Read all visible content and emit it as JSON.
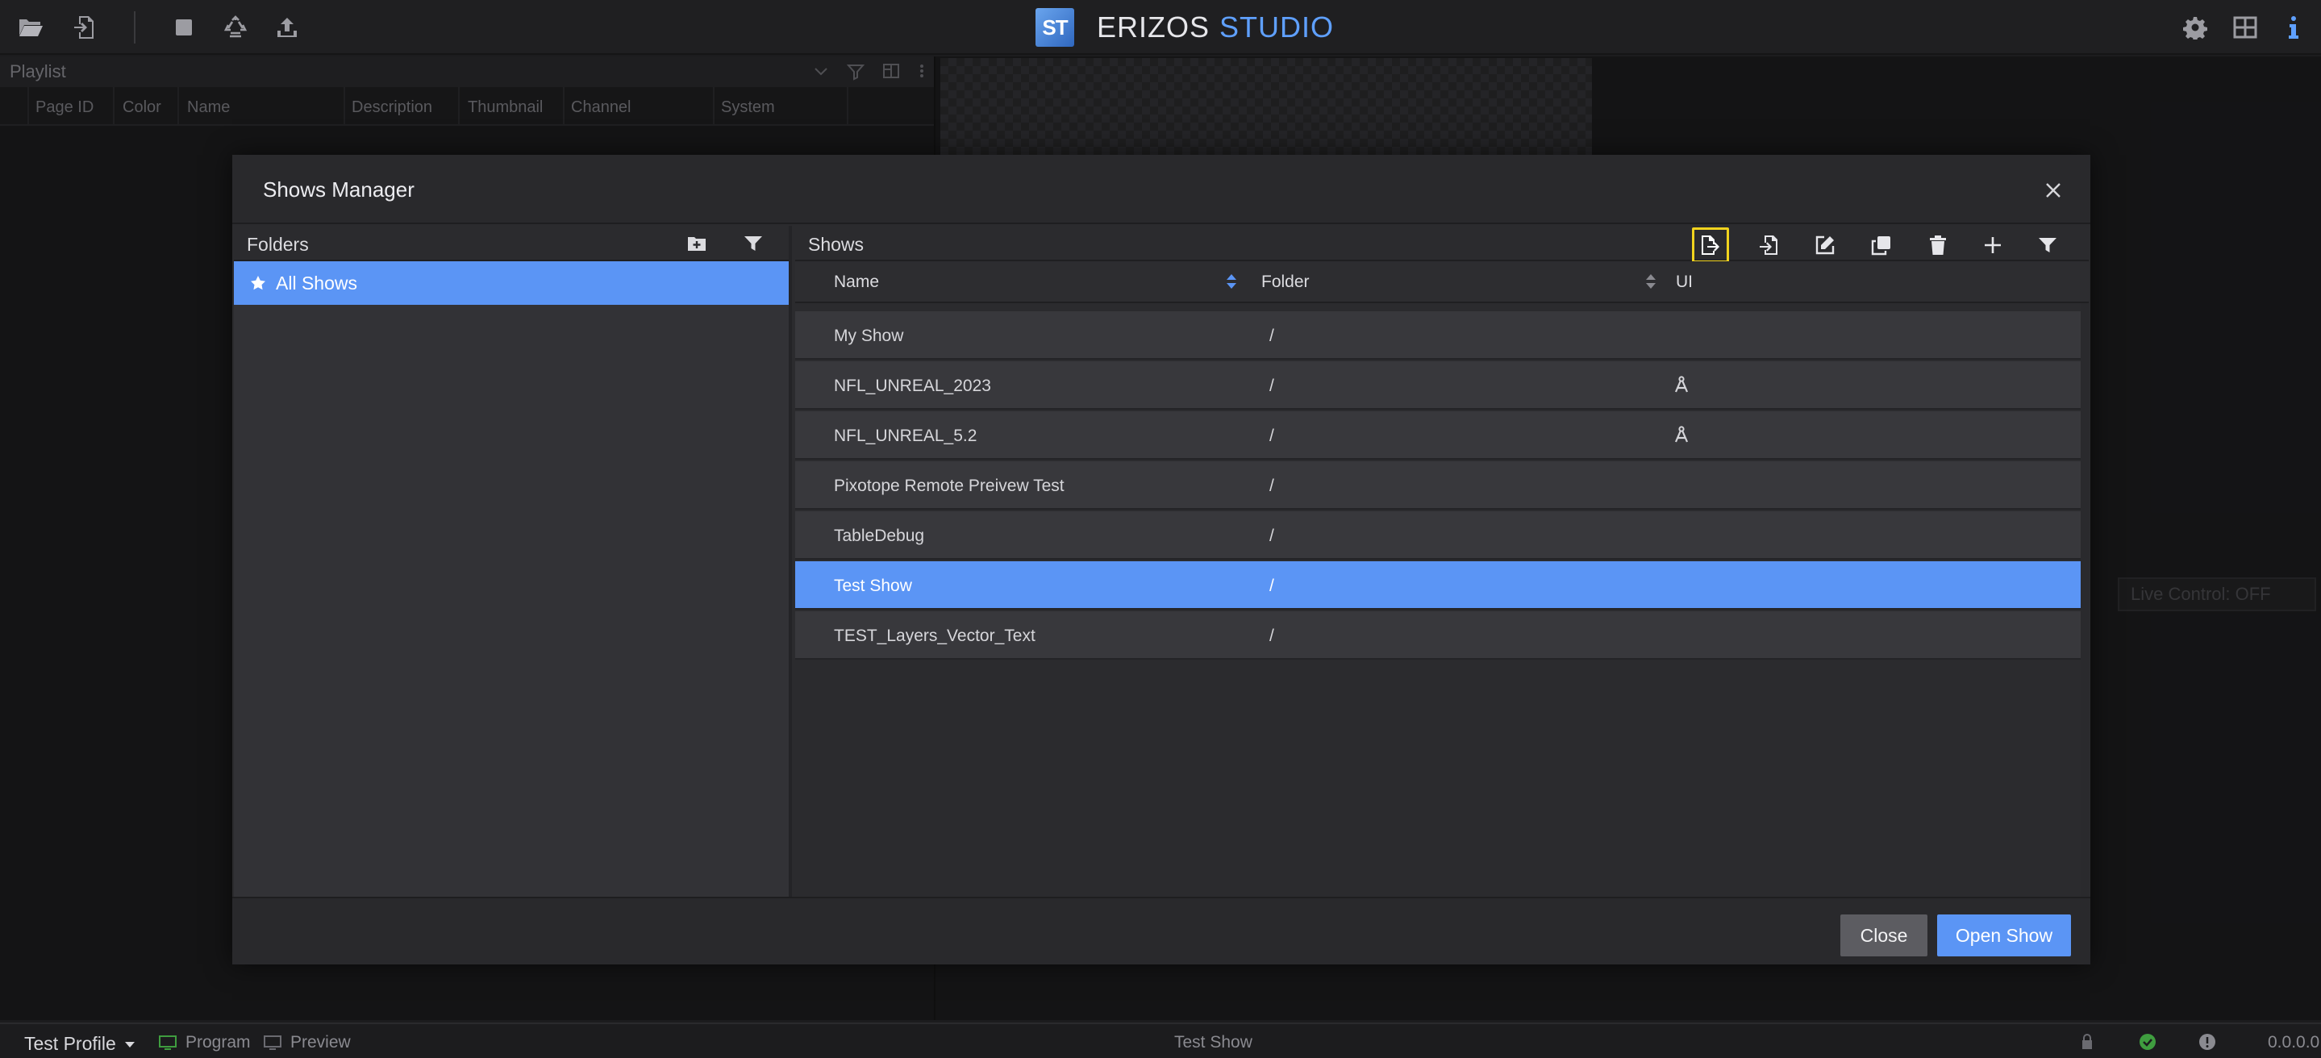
{
  "app": {
    "logo_text": "ST",
    "brand_main": "ERIZOS",
    "brand_accent": "STUDIO",
    "accent_color": "#5fa0ff",
    "selection_color": "#5b95f5",
    "highlight_color": "#f1d31e"
  },
  "toolbar": {
    "left_icons": [
      "folder-open-icon",
      "file-import-icon",
      "stop-icon",
      "recycle-icon",
      "upload-icon"
    ],
    "right_icons": [
      "gear-icon",
      "layout-grid-icon",
      "info-icon"
    ]
  },
  "playlist": {
    "title": "Playlist",
    "columns": [
      "Page ID",
      "Color",
      "Name",
      "Description",
      "Thumbnail",
      "Channel",
      "System"
    ]
  },
  "live_control": {
    "label": "Live Control: OFF"
  },
  "modal": {
    "title": "Shows Manager",
    "folders": {
      "header": "Folders",
      "items": [
        {
          "label": "All Shows",
          "selected": true
        }
      ]
    },
    "shows": {
      "header": "Shows",
      "columns": {
        "name": "Name",
        "folder": "Folder",
        "ui": "UI"
      },
      "rows": [
        {
          "name": "My Show",
          "folder": "/",
          "ui_icon": ""
        },
        {
          "name": "NFL_UNREAL_2023",
          "folder": "/",
          "ui_icon": "compass-icon"
        },
        {
          "name": "NFL_UNREAL_5.2",
          "folder": "/",
          "ui_icon": "compass-icon"
        },
        {
          "name": "Pixotope Remote Preivew Test",
          "folder": "/",
          "ui_icon": ""
        },
        {
          "name": "TableDebug",
          "folder": "/",
          "ui_icon": ""
        },
        {
          "name": "Test Show",
          "folder": "/",
          "ui_icon": "",
          "selected": true
        },
        {
          "name": "TEST_Layers_Vector_Text",
          "folder": "/",
          "ui_icon": ""
        }
      ]
    },
    "footer": {
      "close_label": "Close",
      "open_label": "Open Show"
    }
  },
  "statusbar": {
    "profile": "Test Profile",
    "program": "Program",
    "preview": "Preview",
    "current_show": "Test Show",
    "version": "0.0.0.0"
  }
}
